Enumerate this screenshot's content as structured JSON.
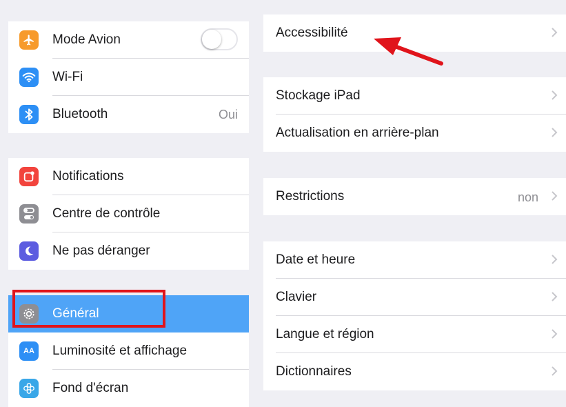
{
  "sidebar": {
    "groups": [
      [
        {
          "label": "Mode Avion",
          "icon": "airplane-icon",
          "color": "#f79a2b",
          "control": "toggle"
        },
        {
          "label": "Wi-Fi",
          "icon": "wifi-icon",
          "color": "#2d8ff5",
          "value": ""
        },
        {
          "label": "Bluetooth",
          "icon": "bluetooth-icon",
          "color": "#2d8ff5",
          "value": "Oui"
        }
      ],
      [
        {
          "label": "Notifications",
          "icon": "notifications-icon",
          "color": "#f2443d"
        },
        {
          "label": "Centre de contrôle",
          "icon": "control-center-icon",
          "color": "#8e8e93"
        },
        {
          "label": "Ne pas déranger",
          "icon": "moon-icon",
          "color": "#5c5ce0"
        }
      ],
      [
        {
          "label": "Général",
          "icon": "gear-icon",
          "color": "#8e8e93",
          "selected": true
        },
        {
          "label": "Luminosité et affichage",
          "icon": "text-size-icon",
          "color": "#2d8ff5"
        },
        {
          "label": "Fond d'écran",
          "icon": "wallpaper-icon",
          "color": "#39a7e8"
        }
      ]
    ]
  },
  "main": {
    "groups": [
      [
        {
          "label": "Accessibilité"
        }
      ],
      [
        {
          "label": "Stockage iPad"
        },
        {
          "label": "Actualisation en arrière-plan"
        }
      ],
      [
        {
          "label": "Restrictions",
          "value": "non"
        }
      ],
      [
        {
          "label": "Date et heure"
        },
        {
          "label": "Clavier"
        },
        {
          "label": "Langue et région"
        },
        {
          "label": "Dictionnaires"
        }
      ]
    ]
  },
  "annotations": {
    "highlight_color": "#e0141b",
    "selected_color": "#4fa4f7"
  }
}
